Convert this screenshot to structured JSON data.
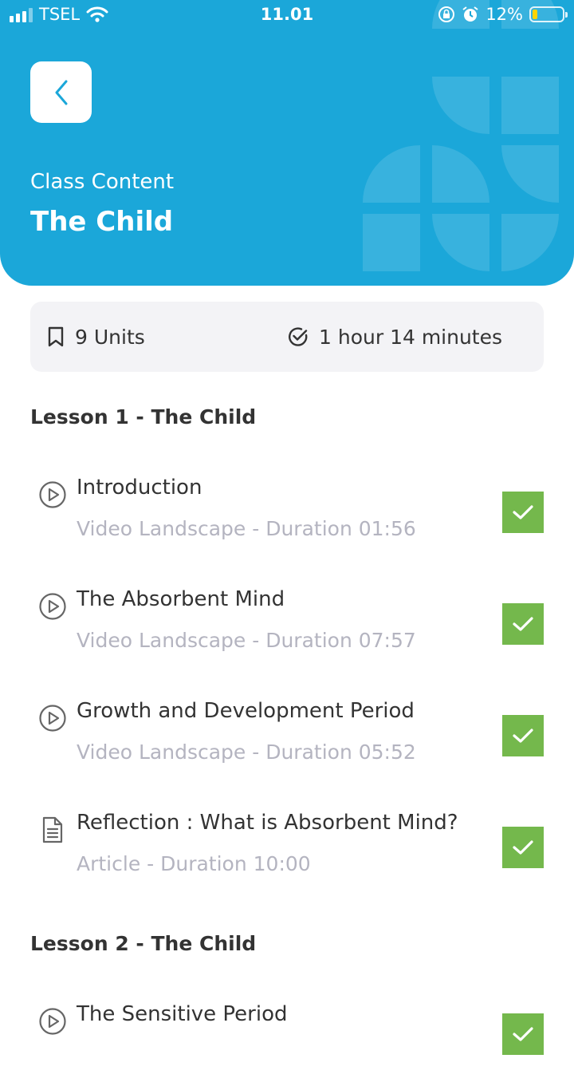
{
  "status_bar": {
    "carrier": "TSEL",
    "time": "11.01",
    "battery_percent": "12%"
  },
  "header": {
    "subtitle": "Class Content",
    "title": "The Child",
    "background_color": "#1ba7d9"
  },
  "summary": {
    "units_label": "9 Units",
    "duration_label": "1 hour 14 minutes"
  },
  "lessons": [
    {
      "title": "Lesson 1 - The Child",
      "units": [
        {
          "icon": "play-circle-icon",
          "title": "Introduction",
          "meta": "Video Landscape  - Duration 01:56",
          "completed": true
        },
        {
          "icon": "play-circle-icon",
          "title": "The Absorbent Mind",
          "meta": "Video Landscape  - Duration 07:57",
          "completed": true
        },
        {
          "icon": "play-circle-icon",
          "title": "Growth and Development Period",
          "meta": "Video Landscape  - Duration 05:52",
          "completed": true
        },
        {
          "icon": "document-icon",
          "title": "Reflection : What is Absorbent Mind?",
          "meta": "Article  - Duration 10:00",
          "completed": true
        }
      ]
    },
    {
      "title": "Lesson 2 - The Child",
      "units": [
        {
          "icon": "play-circle-icon",
          "title": "The Sensitive Period",
          "meta": "",
          "completed": true
        }
      ]
    }
  ],
  "colors": {
    "accent": "#1ba7d9",
    "completed": "#74b84c",
    "meta_text": "#b4b4c0"
  }
}
